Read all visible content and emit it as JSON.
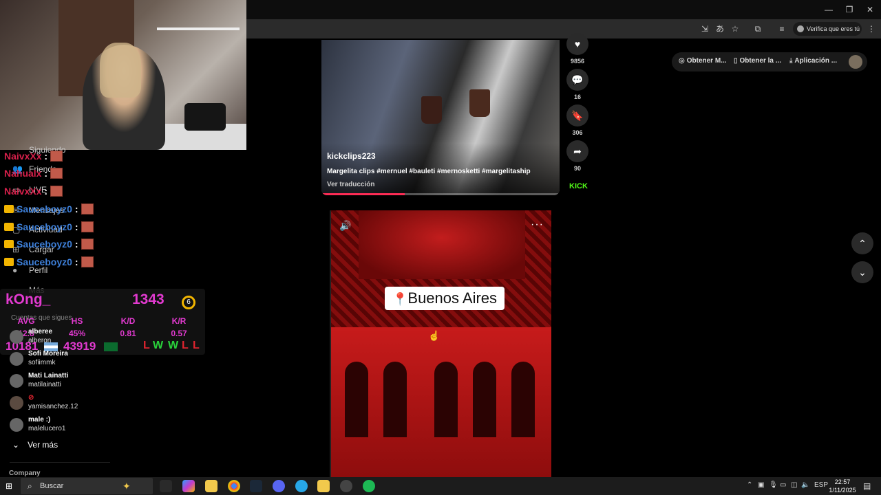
{
  "browser": {
    "verify_label": "Verifica que eres tú",
    "window_controls": [
      "—",
      "❐",
      "✕"
    ]
  },
  "sidebar": {
    "nav": [
      {
        "label": "Siguiendo",
        "icon": "following-icon"
      },
      {
        "label": "Friends",
        "icon": "friends-icon"
      },
      {
        "label": "LIVE",
        "icon": "live-icon"
      },
      {
        "label": "Mensajes",
        "icon": "messages-icon"
      },
      {
        "label": "Actividad",
        "icon": "activity-icon"
      },
      {
        "label": "Cargar",
        "icon": "upload-icon"
      },
      {
        "label": "Perfil",
        "icon": "profile-icon"
      },
      {
        "label": "Más",
        "icon": "more-icon"
      }
    ],
    "following_header": "Cuentas que sigues",
    "following": [
      {
        "name": "alberee",
        "handle": "alberon"
      },
      {
        "name": "Sofi Moreira",
        "handle": "sofiimmk"
      },
      {
        "name": "Mati Lainatti",
        "handle": "matilainatti"
      },
      {
        "name": "",
        "handle": "yamisanchez.12"
      },
      {
        "name": "male :)",
        "handle": "malelucero1"
      }
    ],
    "see_more": "Ver más",
    "company": "Company"
  },
  "chat_overlay": {
    "lines": [
      {
        "user": "NaivxXx",
        "sep": ":"
      },
      {
        "user": "Nahualx",
        "sep": ":"
      },
      {
        "user": "NaivxXx",
        "sep": ":"
      },
      {
        "user": "Sauceboyz0",
        "sep": ":"
      },
      {
        "user": "Sauceboyz0",
        "sep": ":"
      },
      {
        "user": "Sauceboyz0",
        "sep": ":"
      },
      {
        "user": "Sauceboyz0",
        "sep": ":"
      }
    ]
  },
  "stats": {
    "player": "kOng_",
    "elo": "1343",
    "level": "6",
    "headers": [
      "AVG",
      "HS",
      "K/D",
      "K/R"
    ],
    "values": [
      "12.8",
      "45%",
      "0.81",
      "0.57"
    ],
    "num1": "10181",
    "num2": "43919",
    "results": [
      "L",
      "W",
      "W",
      "L",
      "L"
    ]
  },
  "video1": {
    "author": "kickclips223",
    "caption": "Margelita clips #mernuel #bauleti #mernosketti #margelitaship",
    "translate": "Ver traducción",
    "progress": 0.35,
    "likes": "9856",
    "comments": "16",
    "saves": "306",
    "shares": "90",
    "brand": "KICK"
  },
  "video2": {
    "sticker_text": "Buenos Aires",
    "more": "···"
  },
  "topbar": {
    "items": [
      "Obtener M...",
      "Obtener la ...",
      "Aplicación ..."
    ]
  },
  "taskbar": {
    "search_placeholder": "Buscar",
    "lang": "ESP",
    "time": "22:57",
    "date": "1/11/2025"
  }
}
